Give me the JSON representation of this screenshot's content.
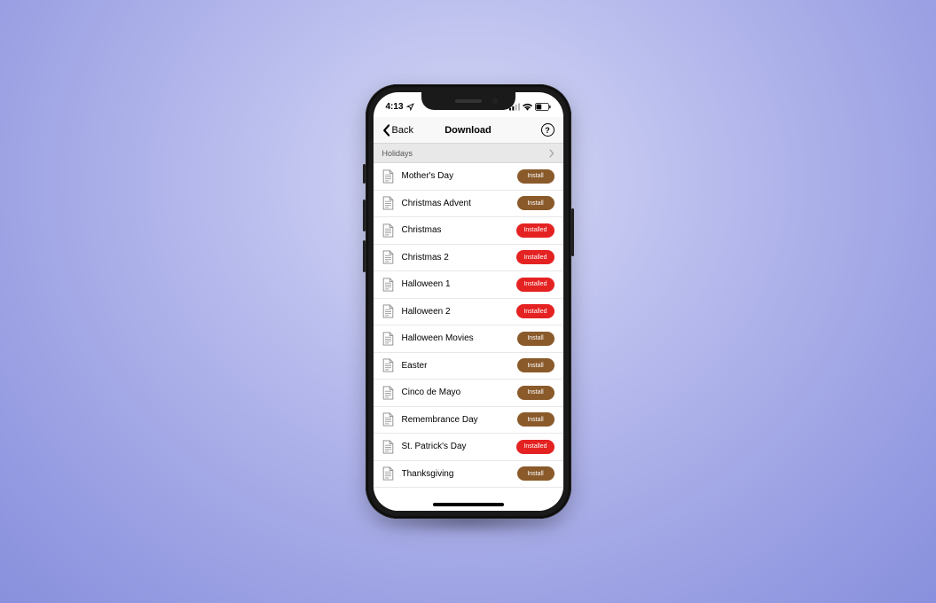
{
  "status": {
    "time": "4:13",
    "location_arrow": "➤"
  },
  "nav": {
    "back": "Back",
    "title": "Download",
    "help": "?"
  },
  "section": {
    "header": "Holidays"
  },
  "labels": {
    "install": "Install",
    "installed": "Installed"
  },
  "items": [
    {
      "name": "Mother's Day",
      "state": "install"
    },
    {
      "name": "Christmas Advent",
      "state": "install"
    },
    {
      "name": "Christmas",
      "state": "installed"
    },
    {
      "name": "Christmas 2",
      "state": "installed"
    },
    {
      "name": "Halloween 1",
      "state": "installed"
    },
    {
      "name": "Halloween 2",
      "state": "installed"
    },
    {
      "name": "Halloween Movies",
      "state": "install"
    },
    {
      "name": "Easter",
      "state": "install"
    },
    {
      "name": "Cinco de Mayo",
      "state": "install"
    },
    {
      "name": "Remembrance Day",
      "state": "install"
    },
    {
      "name": "St. Patrick's Day",
      "state": "installed"
    },
    {
      "name": "Thanksgiving",
      "state": "install"
    }
  ]
}
